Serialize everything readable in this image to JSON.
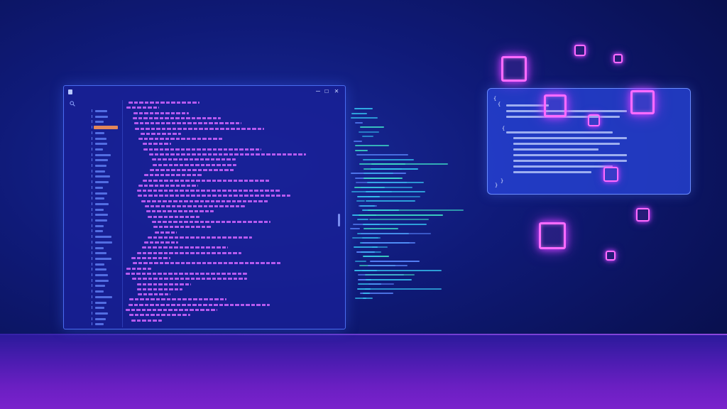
{
  "window": {
    "controls": {
      "minimize": "—",
      "maximize": "☐",
      "close": "✕"
    },
    "sidebar": {
      "search_icon": "search-icon"
    },
    "selected_row": 3
  },
  "colors": {
    "background": "#0f1a78",
    "window_fill": "#1820a0",
    "window_border": "#4a6cf0",
    "code_text": "#c85cff",
    "sidebar_bar": "#5d7bf0",
    "selected_highlight": "#e3875a",
    "floating_code": "#35c0f0",
    "cube_glow": "#ff6bff",
    "floor": "#6a1fc2"
  }
}
